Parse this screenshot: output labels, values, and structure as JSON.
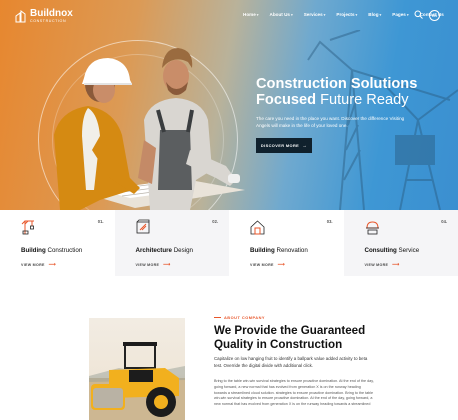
{
  "brand": {
    "name": "Buildnox",
    "tagline": "CONSTRUCTION"
  },
  "nav": {
    "items": [
      {
        "label": "Home",
        "dropdown": true
      },
      {
        "label": "About Us",
        "dropdown": true
      },
      {
        "label": "Services",
        "dropdown": true
      },
      {
        "label": "Projects",
        "dropdown": true
      },
      {
        "label": "Blog",
        "dropdown": true
      },
      {
        "label": "Pages",
        "dropdown": true
      },
      {
        "label": "Contact Us",
        "dropdown": false
      }
    ],
    "search_icon": "search-icon",
    "lang": "EN"
  },
  "hero": {
    "title_line1": "Construction Solutions",
    "title_bold2": "Focused",
    "title_light2": "Future Ready",
    "description": "The care you need in the place you want. Discover the difference Visiting Angels will make in the life of your loved one.",
    "button_label": "DISCOVER MORE",
    "colors": {
      "orange": "#e7872f",
      "blue": "#3b8fd0",
      "button": "#10212d"
    }
  },
  "services": [
    {
      "number": "01.",
      "title_bold": "Building",
      "title_rest": "Construction",
      "link": "VIEW MORE",
      "icon": "crane-icon"
    },
    {
      "number": "02.",
      "title_bold": "Architecture",
      "title_rest": "Design",
      "link": "VIEW MORE",
      "icon": "blueprint-icon"
    },
    {
      "number": "03.",
      "title_bold": "Building",
      "title_rest": "Renovation",
      "link": "VIEW MORE",
      "icon": "house-renovation-icon"
    },
    {
      "number": "04.",
      "title_bold": "Consulting",
      "title_rest": "Service",
      "link": "VIEW MORE",
      "icon": "helmet-consulting-icon"
    }
  ],
  "about": {
    "tag": "ABOUT COMPANY",
    "title": "We Provide the Guaranteed Quality in Construction",
    "lead": "Capitalize on low hanging fruit to identify a ballpark value added activity to beta test. Override the digital divide with additional click.",
    "body": "Bring to the table win-win survival strategies to ensure proactive domination. At the end of the day, going forward, a new normal that has evolved from generation X is on the runway heading towards a streamlined cloud solution. strategies to ensure proactive domination. Bring to the table win-win survival strategies to ensure proactive domination. At the end of the day, going forward, a new normal that has evolved from generation X is on the runway heading towards a streamlined",
    "accent": "#e8562a"
  }
}
